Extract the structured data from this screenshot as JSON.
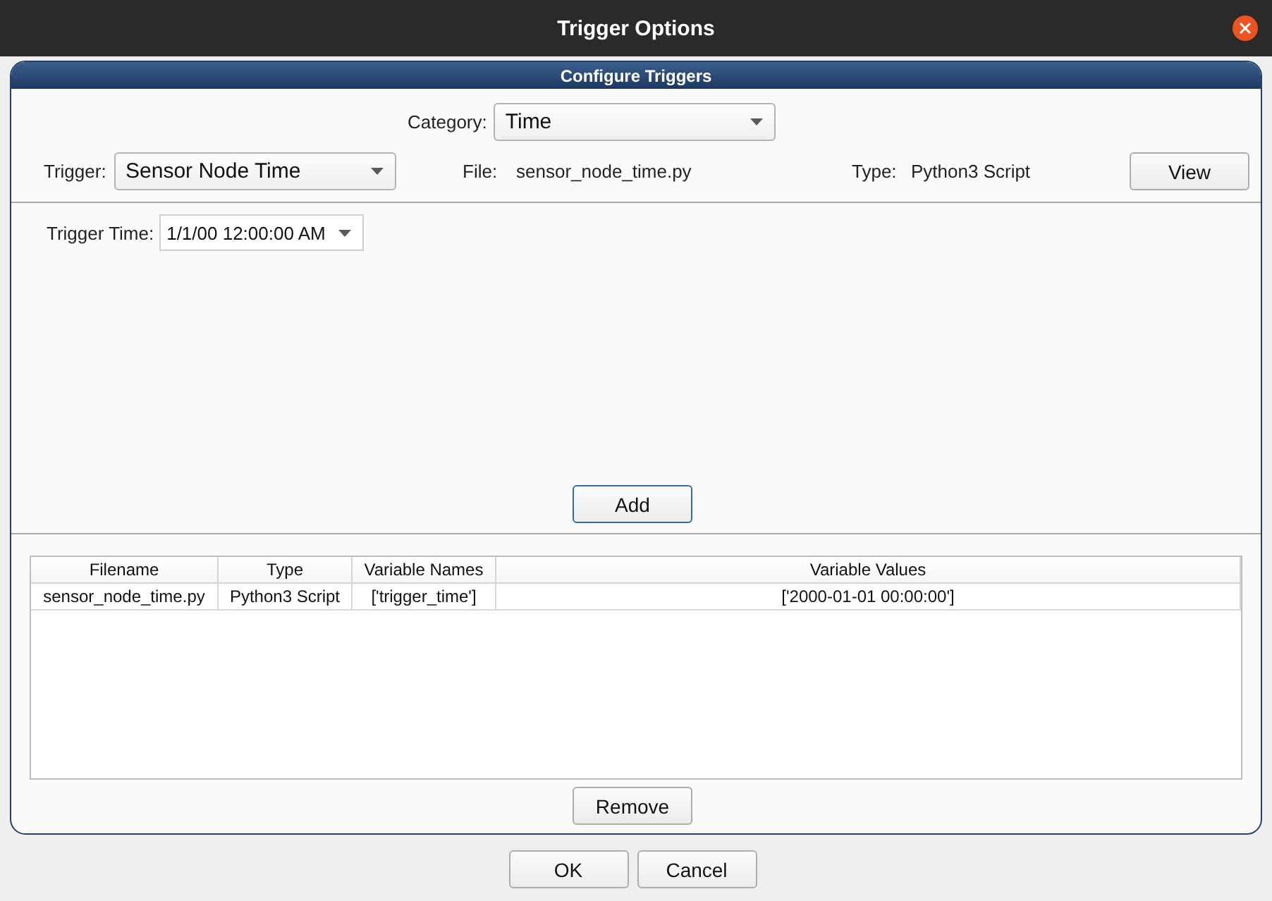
{
  "window": {
    "title": "Trigger Options"
  },
  "panel": {
    "title": "Configure Triggers"
  },
  "category": {
    "label": "Category:",
    "value": "Time"
  },
  "trigger": {
    "label": "Trigger:",
    "value": "Sensor Node Time"
  },
  "file": {
    "label": "File:",
    "value": "sensor_node_time.py"
  },
  "type": {
    "label": "Type:",
    "value": "Python3 Script"
  },
  "view_button": {
    "label": "View"
  },
  "parameters": [
    {
      "label": "Trigger Time:",
      "value": "1/1/00 12:00:00 AM"
    }
  ],
  "add_button": {
    "label": "Add",
    "focused": true
  },
  "table": {
    "columns": [
      "Filename",
      "Type",
      "Variable Names",
      "Variable Values"
    ],
    "rows": [
      [
        "sensor_node_time.py",
        "Python3 Script",
        "['trigger_time']",
        "['2000-01-01 00:00:00']"
      ]
    ]
  },
  "remove_button": {
    "label": "Remove"
  },
  "buttons": [
    {
      "label": "OK"
    },
    {
      "label": "Cancel"
    }
  ]
}
